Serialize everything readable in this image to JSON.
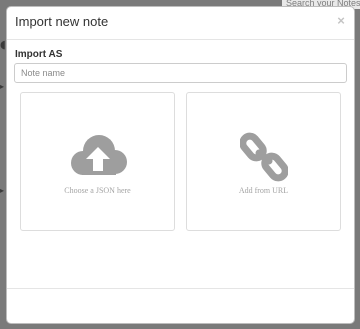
{
  "background": {
    "search_text": "Search your Notes"
  },
  "modal": {
    "title": "Import new note",
    "close_label": "×",
    "import_as_label": "Import AS",
    "name_placeholder": "Note name",
    "name_value": "",
    "options": [
      {
        "label": "Choose a JSON here",
        "icon": "cloud-upload-icon"
      },
      {
        "label": "Add from URL",
        "icon": "link-icon"
      }
    ]
  },
  "colors": {
    "overlay": "#7a7a7a",
    "icon": "#9e9e9e",
    "caption": "#a4a4a4",
    "close": "#c4c4c4"
  }
}
